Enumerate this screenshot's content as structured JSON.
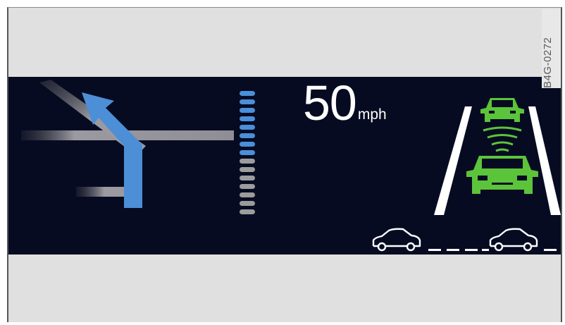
{
  "figure_code": "B4G-0272",
  "speed": {
    "value": "50",
    "unit": "mph"
  },
  "navigation": {
    "icon": "turn-left-arrow-icon"
  },
  "distance_bar": {
    "segments_total": 15,
    "segments_active": 8
  },
  "adaptive_cruise": {
    "lead_car_icon": "lead-vehicle-icon",
    "own_car_icon": "own-vehicle-icon",
    "radar_icon": "radar-waves-icon",
    "lane_icon": "lane-lines-icon"
  },
  "following_distance": {
    "icon": "car-gap-icon"
  },
  "colors": {
    "display_bg": "#070b22",
    "frame_bg": "#e0e0e0",
    "nav_arrow": "#4c8fd6",
    "bar_active": "#4a8fd9",
    "bar_inactive": "#9c9c9c",
    "acc_green": "#5cc43a",
    "text": "#ffffff"
  }
}
